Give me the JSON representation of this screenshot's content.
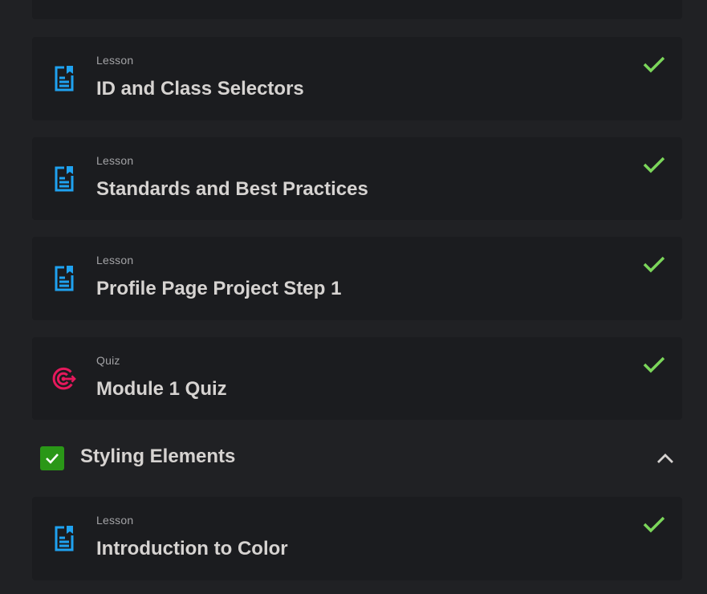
{
  "items": [
    {
      "type": "Lesson",
      "title": "ID and Class Selectors",
      "icon": "lesson-document-icon",
      "completed": true
    },
    {
      "type": "Lesson",
      "title": "Standards and Best Practices",
      "icon": "lesson-document-icon",
      "completed": true
    },
    {
      "type": "Lesson",
      "title": "Profile Page Project Step 1",
      "icon": "lesson-document-icon",
      "completed": true
    },
    {
      "type": "Quiz",
      "title": "Module 1 Quiz",
      "icon": "quiz-target-icon",
      "completed": true
    }
  ],
  "section": {
    "title": "Styling Elements",
    "completed": true,
    "expanded": true,
    "items": [
      {
        "type": "Lesson",
        "title": "Introduction to Color",
        "icon": "lesson-document-icon",
        "completed": true
      }
    ]
  },
  "colors": {
    "page_bg": "#202124",
    "card_bg": "#1b1c1f",
    "lesson_icon": "#1fa2f0",
    "quiz_icon": "#e5195c",
    "check": "#7bd65a",
    "section_check_bg": "#2a9717"
  }
}
